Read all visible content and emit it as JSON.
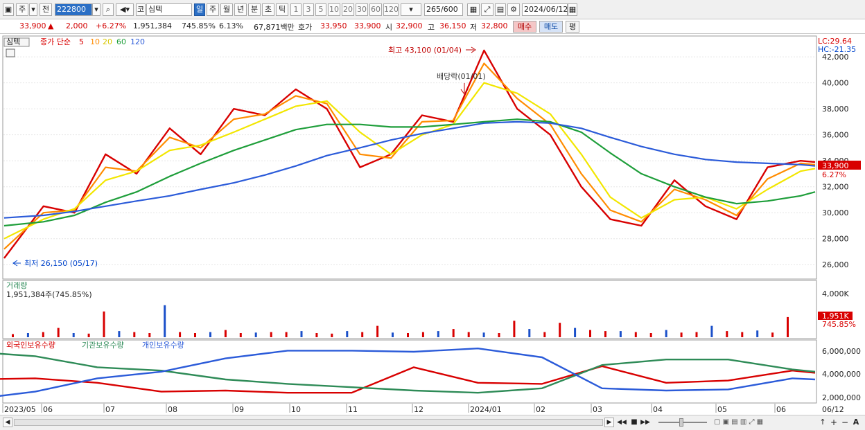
{
  "toolbar": {
    "tab_main": "주",
    "tab_prev": "전",
    "code": "222800",
    "stock_prefix": "코",
    "stock_name": "심텍",
    "period_buttons": [
      "일",
      "주",
      "월",
      "년",
      "분",
      "초",
      "틱"
    ],
    "interval_buttons": [
      "1",
      "3",
      "5",
      "10",
      "20",
      "30",
      "60",
      "120"
    ],
    "count": "265",
    "count_max": "/600",
    "date": "2024/06/12"
  },
  "quote": {
    "price": "33,900",
    "arrow": "▲",
    "change": "2,000",
    "change_pct": "+6.27%",
    "volume": "1,951,384",
    "volume_ratio": "745.85%",
    "turnover": "6.13%",
    "amount": "67,871백만",
    "ask_label": "호가",
    "ask": "33,950",
    "bid": "33,900",
    "open_label": "시",
    "open": "32,900",
    "high_label": "고",
    "high": "36,150",
    "low_label": "저",
    "low": "32,800",
    "buy_label": "매수",
    "sell_label": "매도",
    "eval_label": "평"
  },
  "price_panel": {
    "name": "심텍",
    "ma_label": "종가 단순",
    "ma_periods": [
      "5",
      "10",
      "20",
      "60",
      "120"
    ],
    "lc": "LC:29.64",
    "hc": "HC:-21.35",
    "high_annotation": "최고 43,100 (01/04)",
    "low_annotation": "최저 26,150 (05/17)",
    "dividend_annotation": "배당락(01/01)",
    "current_price_tag": "33,900",
    "current_pct_tag": "6.27%"
  },
  "volume_panel": {
    "title": "거래량",
    "value_label": "1,951,384주(745.85%)",
    "scale_label": "4,000K",
    "current_tag": "1,951K",
    "current_pct": "745.85%"
  },
  "holding_panel": {
    "legend": [
      "외국인보유수량",
      "기관보유수량",
      "개인보유수량"
    ],
    "scale_labels": [
      "6,000,000",
      "4,000,000",
      "2,000,000"
    ]
  },
  "x_axis": {
    "labels": [
      "2023/05",
      "06",
      "07",
      "08",
      "09",
      "10",
      "11",
      "12",
      "2024/01",
      "02",
      "03",
      "04",
      "05",
      "06",
      "06/12"
    ]
  },
  "chart_data": [
    {
      "type": "line",
      "title": "심텍",
      "xlabel": "",
      "ylabel": "",
      "ylim": [
        25000,
        43500
      ],
      "y_ticks": [
        26000,
        28000,
        30000,
        32000,
        34000,
        36000,
        38000,
        40000,
        42000
      ],
      "x": [
        "2023-05-17",
        "2023-06-05",
        "2023-06-20",
        "2023-07-05",
        "2023-07-20",
        "2023-08-05",
        "2023-08-20",
        "2023-09-05",
        "2023-09-20",
        "2023-10-05",
        "2023-10-20",
        "2023-11-05",
        "2023-11-20",
        "2023-12-05",
        "2023-12-20",
        "2024-01-04",
        "2024-01-20",
        "2024-02-05",
        "2024-02-20",
        "2024-03-05",
        "2024-03-20",
        "2024-04-05",
        "2024-04-20",
        "2024-05-05",
        "2024-05-20",
        "2024-06-05",
        "2024-06-12"
      ],
      "series": [
        {
          "name": "5",
          "color": "#d80000",
          "values": [
            26500,
            30500,
            30000,
            34500,
            33000,
            36500,
            34500,
            38000,
            37500,
            39500,
            38000,
            33500,
            34500,
            37500,
            37000,
            42500,
            38000,
            36000,
            32000,
            29500,
            29000,
            32500,
            30500,
            29500,
            33500,
            34000,
            33900
          ]
        },
        {
          "name": "10",
          "color": "#ff8c00",
          "values": [
            27200,
            30000,
            30200,
            33500,
            33200,
            35800,
            35000,
            37200,
            37600,
            39000,
            38400,
            34500,
            34200,
            37000,
            37100,
            41500,
            38800,
            36800,
            33000,
            30200,
            29300,
            31800,
            31000,
            29800,
            32600,
            33800,
            33700
          ]
        },
        {
          "name": "20",
          "color": "#f2e600",
          "values": [
            28000,
            29500,
            30300,
            32500,
            33200,
            34800,
            35200,
            36200,
            37200,
            38200,
            38600,
            36200,
            34500,
            36000,
            36800,
            40000,
            39200,
            37600,
            34500,
            31200,
            29600,
            31000,
            31200,
            30300,
            31800,
            33200,
            33400
          ]
        },
        {
          "name": "60",
          "color": "#1e9e3a",
          "values": [
            29000,
            29300,
            29800,
            30800,
            31600,
            32800,
            33800,
            34800,
            35600,
            36400,
            36800,
            36800,
            36600,
            36600,
            36800,
            37000,
            37200,
            37000,
            36200,
            34600,
            33000,
            32000,
            31200,
            30700,
            30900,
            31300,
            31600
          ]
        },
        {
          "name": "120",
          "color": "#2b5bd9",
          "values": [
            29600,
            29800,
            30100,
            30500,
            30900,
            31300,
            31800,
            32300,
            32900,
            33600,
            34400,
            35000,
            35600,
            36100,
            36500,
            36900,
            37000,
            36900,
            36500,
            35800,
            35100,
            34500,
            34100,
            33900,
            33800,
            33700,
            33600
          ]
        }
      ]
    },
    {
      "type": "bar",
      "title": "거래량",
      "ylim": [
        0,
        4500000
      ],
      "values": [
        300000,
        400000,
        500000,
        900000,
        400000,
        350000,
        2500000,
        600000,
        500000,
        400000,
        3100000,
        500000,
        400000,
        500000,
        700000,
        400000,
        450000,
        500000,
        500000,
        600000,
        400000,
        350000,
        600000,
        500000,
        1100000,
        450000,
        400000,
        500000,
        600000,
        800000,
        500000,
        450000,
        400000,
        1600000,
        800000,
        500000,
        1400000,
        900000,
        700000,
        600000,
        600000,
        500000,
        400000,
        700000,
        450000,
        500000,
        1100000,
        600000,
        500000,
        650000,
        450000,
        1951384
      ]
    },
    {
      "type": "line",
      "title": "보유수량",
      "ylim": [
        1500000,
        6500000
      ],
      "x": [
        "2023-05",
        "2023-06",
        "2023-07",
        "2023-08",
        "2023-09",
        "2023-10",
        "2023-11",
        "2023-12",
        "2024-01",
        "2024-02",
        "2024-03",
        "2024-04",
        "2024-05",
        "2024-06",
        "2024-06-12"
      ],
      "series": [
        {
          "name": "외국인보유수량",
          "color": "#d80000",
          "values": [
            3500000,
            3600000,
            3200000,
            2400000,
            2500000,
            2300000,
            2300000,
            4600000,
            3200000,
            3100000,
            4700000,
            3200000,
            3400000,
            4300000,
            4100000
          ]
        },
        {
          "name": "기관보유수량",
          "color": "#2e8b57",
          "values": [
            6000000,
            5600000,
            4600000,
            4300000,
            3500000,
            3100000,
            2800000,
            2500000,
            2300000,
            2700000,
            4800000,
            5300000,
            5300000,
            4400000,
            4200000
          ]
        },
        {
          "name": "개인보유수량",
          "color": "#2b5bd9",
          "values": [
            1700000,
            2400000,
            3600000,
            4200000,
            5400000,
            6100000,
            6100000,
            6000000,
            6300000,
            5500000,
            2700000,
            2500000,
            2600000,
            3600000,
            3500000
          ]
        }
      ]
    }
  ]
}
